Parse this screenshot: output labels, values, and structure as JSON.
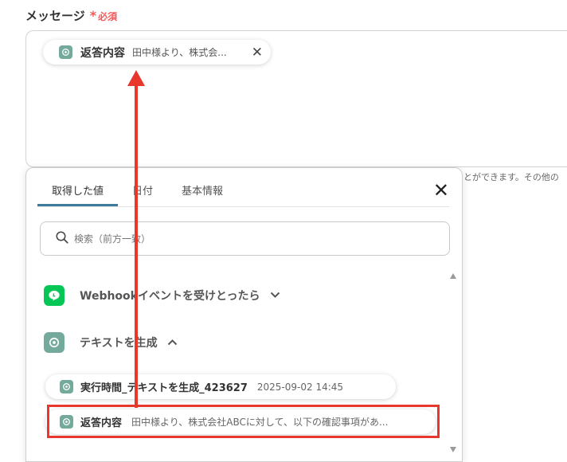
{
  "form": {
    "message_label": "メッセージ",
    "required_star": "*",
    "required_text": "必須",
    "chip": {
      "name": "返答内容",
      "preview": "田中様より、株式会...",
      "close": "✕"
    },
    "side_text": "とができます。その他の"
  },
  "popup": {
    "tabs": [
      {
        "label": "取得した値",
        "active": true
      },
      {
        "label": "日付",
        "active": false
      },
      {
        "label": "基本情報",
        "active": false
      }
    ],
    "close": "✕",
    "search_placeholder": "検索（前方一致）",
    "groups": [
      {
        "label": "Webhookイベントを受けとったら",
        "icon": "line-icon",
        "chevron": "⌄"
      },
      {
        "label": "テキストを生成",
        "icon": "chatgpt-icon",
        "chevron": "⌃"
      }
    ],
    "items": [
      {
        "name": "実行時間_テキストを生成_423627",
        "preview": "2025-09-02 14:45"
      },
      {
        "name": "返答内容",
        "preview": "田中様より、株式会社ABCに対して、以下の確認事項があ..."
      }
    ]
  },
  "colors": {
    "accent": "#3d7a9b",
    "required": "#ef5b5b",
    "highlight": "#e8372c",
    "line_green": "#06c755",
    "gpt_teal": "#74aa9c"
  }
}
